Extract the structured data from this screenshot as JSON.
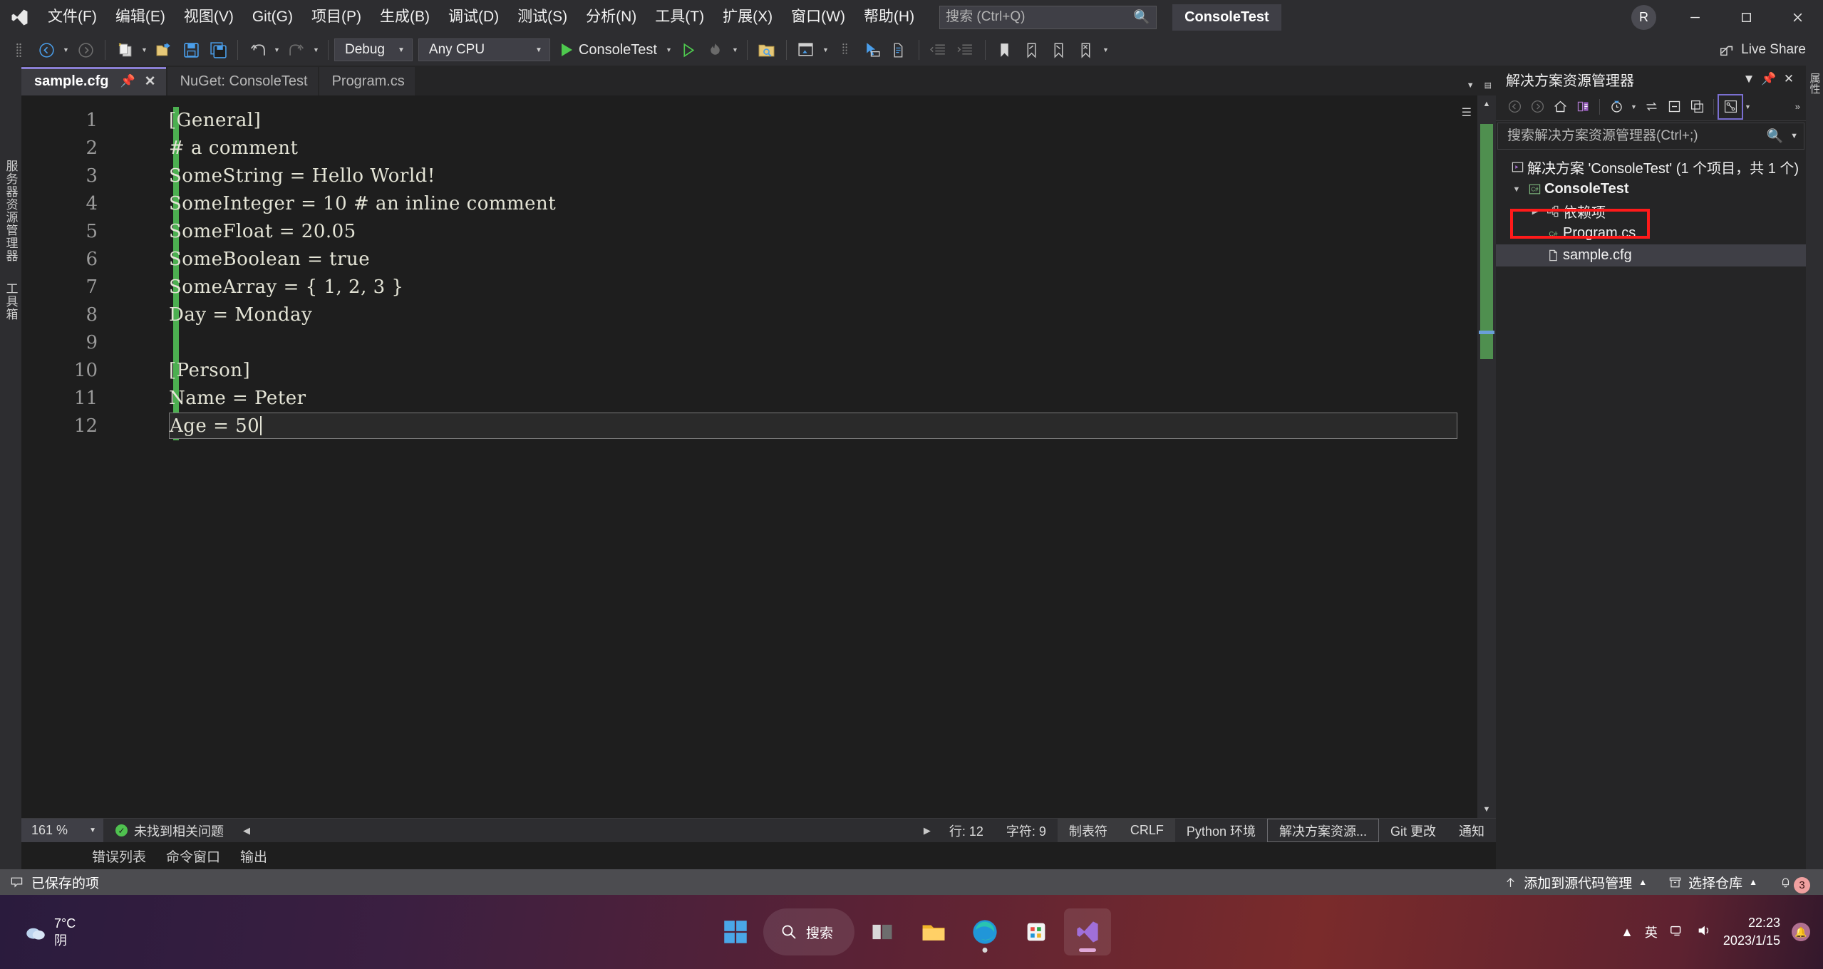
{
  "titlebar": {
    "logo_icon": "visual-studio-logo",
    "menus": [
      {
        "label": "文件(F)"
      },
      {
        "label": "编辑(E)"
      },
      {
        "label": "视图(V)"
      },
      {
        "label": "Git(G)"
      },
      {
        "label": "项目(P)"
      },
      {
        "label": "生成(B)"
      },
      {
        "label": "调试(D)"
      },
      {
        "label": "测试(S)"
      },
      {
        "label": "分析(N)"
      },
      {
        "label": "工具(T)"
      },
      {
        "label": "扩展(X)"
      },
      {
        "label": "窗口(W)"
      },
      {
        "label": "帮助(H)"
      }
    ],
    "search": {
      "placeholder": "搜索 (Ctrl+Q)",
      "value": "",
      "icon": "search-icon"
    },
    "solution_chip": "ConsoleTest",
    "account_initial": "R",
    "window_buttons": {
      "minimize": "minimize-icon",
      "maximize": "maximize-icon",
      "close": "close-icon"
    }
  },
  "toolbar": {
    "nav_back": "navigate-back-icon",
    "nav_forward": "navigate-forward-icon",
    "new_project": "new-project-icon",
    "open_file": "open-file-icon",
    "save": "save-icon",
    "save_all": "save-all-icon",
    "undo": "undo-icon",
    "redo": "redo-icon",
    "config_combo": {
      "value": "Debug"
    },
    "platform_combo": {
      "value": "Any CPU"
    },
    "start_label": "ConsoleTest",
    "start_icon": "run-start-icon",
    "start_no_debug_icon": "run-without-debug-icon",
    "hot_reload_icon": "hot-reload-icon",
    "search_folder_icon": "search-in-folder-icon",
    "window_layout_icon": "window-layout-icon",
    "pointer_select_icon": "pointer-select-icon",
    "compare_icon": "compare-files-icon",
    "outdent_icon": "outdent-icon",
    "indent_icon": "indent-icon",
    "bookmark_icon": "bookmark-icon",
    "prev_bookmark_icon": "previous-bookmark-icon",
    "next_bookmark_icon": "next-bookmark-icon",
    "clear_bookmarks_icon": "clear-bookmarks-icon",
    "live_share": {
      "label": "Live Share",
      "icon": "live-share-icon"
    }
  },
  "left_dock": {
    "tabs": [
      "服务器资源管理器",
      "工具箱"
    ]
  },
  "right_dock": {
    "tabs": [
      "属性"
    ]
  },
  "editor_tabs": [
    {
      "label": "sample.cfg",
      "active": true,
      "pin_icon": "pin-icon",
      "close_icon": "close-icon"
    },
    {
      "label": "NuGet: ConsoleTest",
      "active": false
    },
    {
      "label": "Program.cs",
      "active": false
    }
  ],
  "editor": {
    "line_numbers": [
      "1",
      "2",
      "3",
      "4",
      "5",
      "6",
      "7",
      "8",
      "9",
      "10",
      "11",
      "12"
    ],
    "lines": [
      "[General]",
      "# a comment",
      "SomeString = Hello World!",
      "SomeInteger = 10 # an inline comment",
      "SomeFloat = 20.05",
      "SomeBoolean = true",
      "SomeArray = { 1, 2, 3 }",
      "Day = Monday",
      "",
      "[Person]",
      "Name = Peter",
      "Age = 50"
    ],
    "current_line_index": 11,
    "change_bar_color": "#4caf50"
  },
  "editor_status": {
    "zoom": "161 %",
    "issues_text": "未找到相关问题",
    "issues_icon": "check-circle-icon",
    "line_label": "行: 12",
    "char_label": "字符: 9",
    "tab_label": "制表符",
    "eol_label": "CRLF",
    "python_env": "Python 环境",
    "solution_explorer": "解决方案资源...",
    "git_changes": "Git 更改",
    "notifications": "通知"
  },
  "panel_tabs": [
    "错误列表",
    "命令窗口",
    "输出"
  ],
  "solution_explorer": {
    "title": "解决方案资源管理器",
    "header_buttons": {
      "dropdown": "chevron-down-icon",
      "pin": "pin-icon",
      "close": "close-icon"
    },
    "toolbar_icons": [
      "back-icon",
      "forward-icon",
      "home-icon",
      "sync-with-active-document-icon",
      "pending-changes-icon",
      "refresh-icon",
      "collapse-all-icon",
      "show-all-files-icon",
      "properties-view-icon"
    ],
    "search": {
      "placeholder": "搜索解决方案资源管理器(Ctrl+;)",
      "value": "",
      "icon": "search-icon"
    },
    "tree": [
      {
        "label": "解决方案 'ConsoleTest' (1 个项目，共 1 个)",
        "icon": "solution-icon",
        "indent": 0,
        "arrow": "",
        "bold": false
      },
      {
        "label": "ConsoleTest",
        "icon": "csharp-project-icon",
        "indent": 1,
        "arrow": "▼",
        "bold": true
      },
      {
        "label": "依赖项",
        "icon": "dependencies-icon",
        "indent": 2,
        "arrow": "▶",
        "bold": false
      },
      {
        "label": "Program.cs",
        "icon": "csharp-file-icon",
        "indent": 3,
        "arrow": "",
        "bold": false
      },
      {
        "label": "sample.cfg",
        "icon": "file-icon",
        "indent": 3,
        "arrow": "",
        "bold": false,
        "selected": true,
        "highlighted": true
      }
    ]
  },
  "vs_status_bar": {
    "saved_text": "已保存的项",
    "saved_icon": "saved-item-icon",
    "add_source_control": "添加到源代码管理",
    "add_source_control_icon": "up-arrow-icon",
    "select_repository": "选择仓库",
    "select_repository_icon": "repository-icon",
    "notification_count": "3",
    "notification_icon": "bell-icon"
  },
  "taskbar": {
    "weather": {
      "temp": "7°C",
      "condition": "阴",
      "icon": "cloudy-icon"
    },
    "start_icon": "windows-start-icon",
    "search": {
      "label": "搜索",
      "icon": "search-icon"
    },
    "pinned": [
      {
        "name": "task-view-icon"
      },
      {
        "name": "file-explorer-icon"
      },
      {
        "name": "microsoft-edge-icon"
      },
      {
        "name": "microsoft-store-icon"
      },
      {
        "name": "visual-studio-icon",
        "active": true
      }
    ],
    "tray": {
      "overflow_icon": "chevron-up-icon",
      "language": "英",
      "network_icon": "network-icon",
      "volume_icon": "volume-icon",
      "time": "22:23",
      "date": "2023/1/15",
      "notification_icon": "notification-bell-icon"
    }
  }
}
